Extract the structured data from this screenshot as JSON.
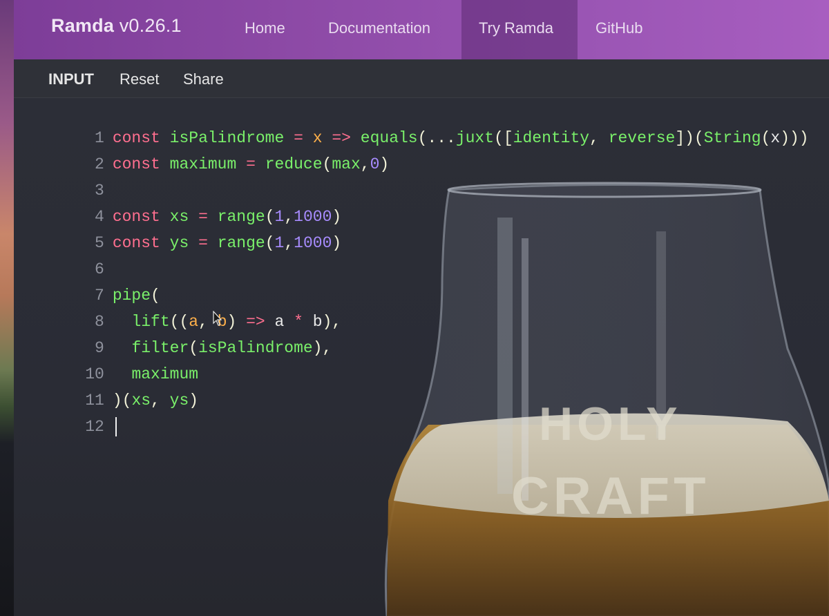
{
  "navbar": {
    "brand_name": "Ramda",
    "brand_version": "v0.26.1",
    "links": [
      "Home",
      "Documentation",
      "Try Ramda",
      "GitHub"
    ],
    "active": "Try Ramda"
  },
  "toolbar": {
    "input_label": "INPUT",
    "reset_label": "Reset",
    "share_label": "Share"
  },
  "editor": {
    "line_numbers": [
      "1",
      "2",
      "3",
      "4",
      "5",
      "6",
      "7",
      "8",
      "9",
      "10",
      "11",
      "12"
    ],
    "lines": [
      "const isPalindrome = x => equals(...juxt([identity, reverse])(String(x)))",
      "const maximum = reduce(max,0)",
      "",
      "const xs = range(1,1000)",
      "const ys = range(1,1000)",
      "",
      "pipe(",
      "  lift((a, b) => a * b),",
      "  filter(isPalindrome),",
      "  maximum",
      ")(xs, ys)",
      ""
    ]
  },
  "photo_overlay": {
    "glass_text_line1": "HOLY",
    "glass_text_line2": "CRAFT"
  },
  "colors": {
    "nav_purple": "#8d4aa6",
    "keyword": "#ff6f8f",
    "function": "#7af06a",
    "variable": "#ffb04a",
    "number": "#a88cff",
    "editor_bg": "#2a2c35"
  }
}
